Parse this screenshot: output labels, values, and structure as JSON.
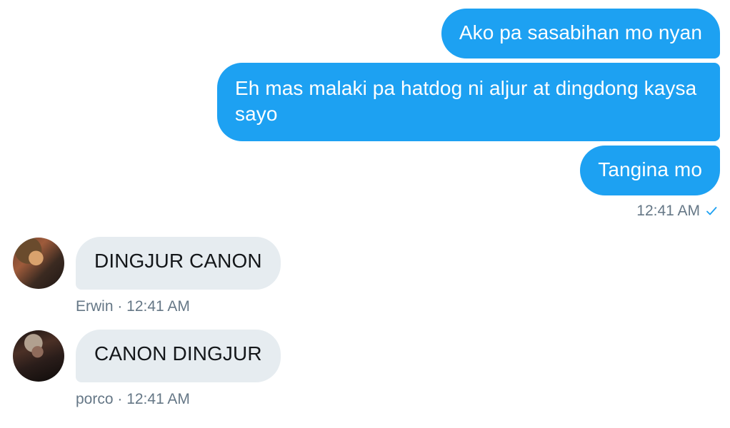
{
  "outgoing": [
    {
      "text": "Ako pa sasabihan mo nyan"
    },
    {
      "text": "Eh mas malaki pa hatdog ni aljur at dingdong kaysa sayo"
    },
    {
      "text": "Tangina mo"
    }
  ],
  "outgoing_meta": {
    "time": "12:41 AM",
    "read_icon": "check-icon"
  },
  "incoming": [
    {
      "text": "DINGJUR CANON",
      "meta": "Erwin · 12:41 AM"
    },
    {
      "text": "CANON DINGJUR",
      "meta": "porco · 12:41 AM"
    }
  ],
  "colors": {
    "outgoing_bubble": "#1da1f2",
    "incoming_bubble": "#e6ecf0",
    "meta_text": "#657786"
  }
}
